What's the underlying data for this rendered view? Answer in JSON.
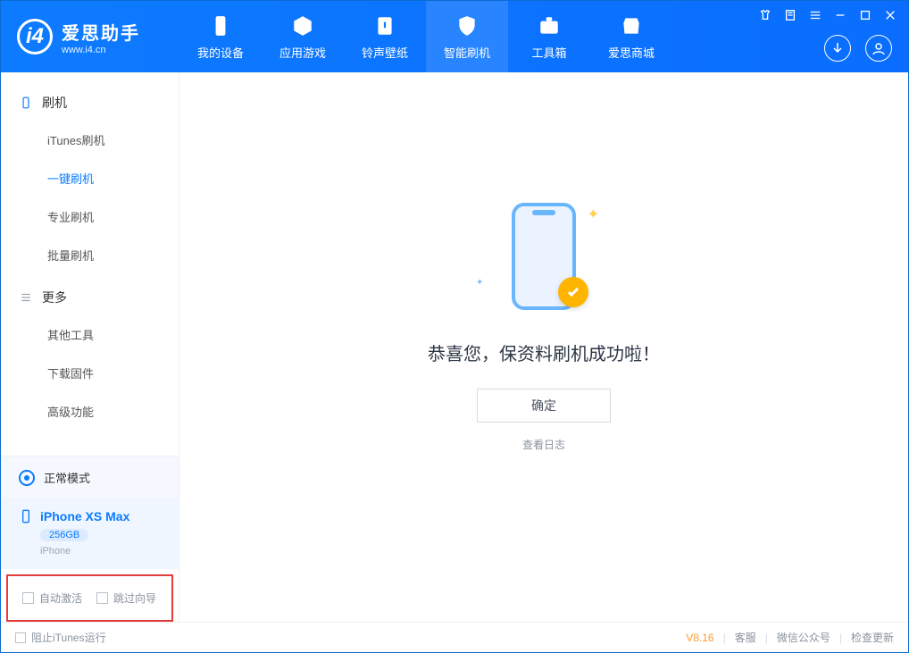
{
  "app": {
    "name": "爱思助手",
    "url": "www.i4.cn"
  },
  "tabs": {
    "device": "我的设备",
    "apps": "应用游戏",
    "ring": "铃声壁纸",
    "flash": "智能刷机",
    "tools": "工具箱",
    "store": "爱思商城"
  },
  "sidebar": {
    "group_flash": "刷机",
    "items_flash": {
      "itunes": "iTunes刷机",
      "oneclick": "一键刷机",
      "pro": "专业刷机",
      "batch": "批量刷机"
    },
    "group_more": "更多",
    "items_more": {
      "other": "其他工具",
      "firmware": "下载固件",
      "advanced": "高级功能"
    }
  },
  "device_panel": {
    "mode": "正常模式",
    "name": "iPhone XS Max",
    "capacity": "256GB",
    "type": "iPhone"
  },
  "options": {
    "auto_activate": "自动激活",
    "skip_guide": "跳过向导"
  },
  "main": {
    "message": "恭喜您，保资料刷机成功啦！",
    "ok": "确定",
    "view_log": "查看日志"
  },
  "status": {
    "block_itunes": "阻止iTunes运行",
    "version": "V8.16",
    "support": "客服",
    "wechat": "微信公众号",
    "update": "检查更新"
  }
}
